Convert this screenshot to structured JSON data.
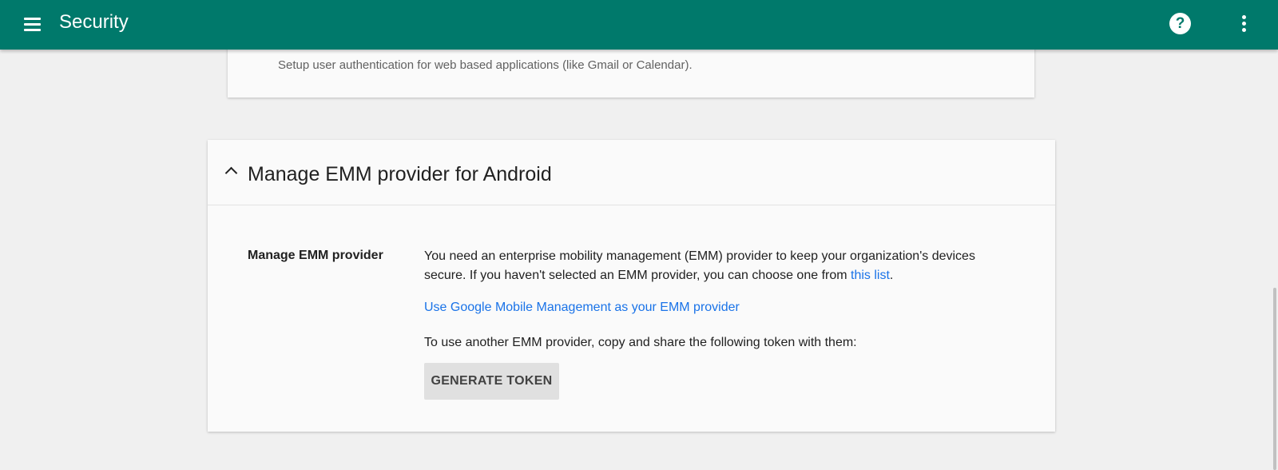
{
  "appbar": {
    "title": "Security",
    "menu_icon": "hamburger-menu-icon",
    "help_icon": "help-icon",
    "help_glyph": "?",
    "more_icon": "more-vert-icon",
    "color": "#00796b"
  },
  "top_card": {
    "description": "Setup user authentication for web based applications (like Gmail or Calendar)."
  },
  "emm_section": {
    "title": "Manage EMM provider for Android",
    "expanded_icon": "chevron-up-icon",
    "setting_label": "Manage EMM provider",
    "description_part1": "You need an enterprise mobility management (EMM) provider to keep your organization's devices secure. If you haven't selected an EMM provider, you can choose one from ",
    "description_link": "this list",
    "description_end": ".",
    "google_mm_link": "Use Google Mobile Management as your EMM provider",
    "token_instruction": "To use another EMM provider, copy and share the following token with them:",
    "generate_button": "GENERATE TOKEN"
  },
  "colors": {
    "link": "#1a73e8",
    "background": "#f0f0f0",
    "card": "#fafafa"
  }
}
